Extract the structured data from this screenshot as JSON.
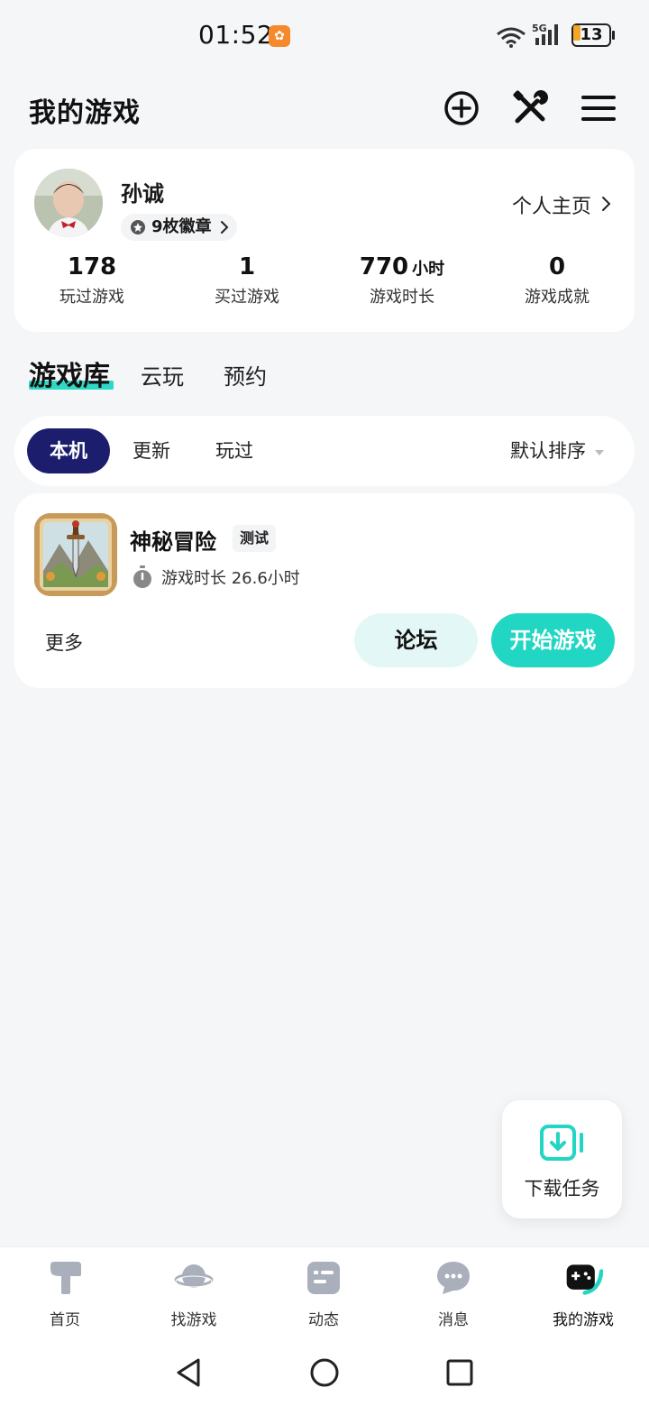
{
  "status_bar": {
    "time": "01:52",
    "network": "5G",
    "battery": "13"
  },
  "header": {
    "title": "我的游戏",
    "icons": [
      "add-circle-icon",
      "tools-icon",
      "menu-icon"
    ]
  },
  "profile": {
    "username": "孙诚",
    "badges": "9枚徽章",
    "profile_link": "个人主页",
    "stats": [
      {
        "value": "178",
        "unit": "",
        "label": "玩过游戏"
      },
      {
        "value": "1",
        "unit": "",
        "label": "买过游戏"
      },
      {
        "value": "770",
        "unit": "小时",
        "label": "游戏时长"
      },
      {
        "value": "0",
        "unit": "",
        "label": "游戏成就"
      }
    ]
  },
  "main_tabs": [
    {
      "label": "游戏库",
      "active": true
    },
    {
      "label": "云玩",
      "active": false
    },
    {
      "label": "预约",
      "active": false
    }
  ],
  "filter": {
    "chips": [
      {
        "label": "本机",
        "active": true
      },
      {
        "label": "更新",
        "active": false
      },
      {
        "label": "玩过",
        "active": false
      }
    ],
    "sort_label": "默认排序"
  },
  "game": {
    "name": "神秘冒险",
    "tag": "测试",
    "playtime": "游戏时长 26.6小时",
    "more": "更多",
    "forum_button": "论坛",
    "start_button": "开始游戏"
  },
  "download_float": {
    "label": "下载任务"
  },
  "bottom_nav": [
    {
      "label": "首页",
      "icon": "home-icon",
      "active": false
    },
    {
      "label": "找游戏",
      "icon": "planet-icon",
      "active": false
    },
    {
      "label": "动态",
      "icon": "feed-icon",
      "active": false
    },
    {
      "label": "消息",
      "icon": "message-icon",
      "active": false
    },
    {
      "label": "我的游戏",
      "icon": "gamepad-icon",
      "active": true
    }
  ],
  "colors": {
    "accent": "#21d6c2",
    "chip_active": "#1c1d6d",
    "background": "#f5f6f8"
  }
}
